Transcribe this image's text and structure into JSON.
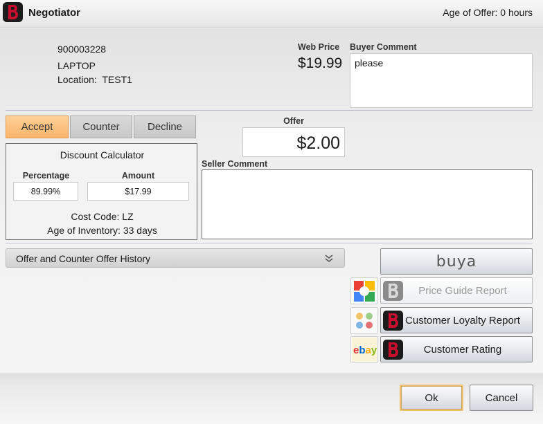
{
  "window": {
    "title": "Negotiator",
    "age_of_offer": "Age of Offer: 0 hours"
  },
  "item": {
    "number": "900003228",
    "name": "LAPTOP",
    "location": "Location:  TEST1"
  },
  "web_price": {
    "label": "Web Price",
    "value": "$19.99"
  },
  "buyer_comment": {
    "label": "Buyer Comment",
    "value": "please"
  },
  "tabs": {
    "accept": "Accept",
    "counter": "Counter",
    "decline": "Decline"
  },
  "calculator": {
    "title": "Discount Calculator",
    "percentage_label": "Percentage",
    "percentage_value": "89.99%",
    "amount_label": "Amount",
    "amount_value": "$17.99",
    "cost_code": "Cost Code: LZ",
    "age_of_inventory": "Age of Inventory: 33 days"
  },
  "offer": {
    "label": "Offer",
    "value": "$2.00"
  },
  "seller_comment": {
    "label": "Seller Comment",
    "value": ""
  },
  "history": {
    "label": "Offer and Counter Offer History"
  },
  "side_buttons": {
    "buya_label": "buya",
    "price_guide": "Price Guide Report",
    "customer_loyalty": "Customer Loyalty Report",
    "customer_rating": "Customer Rating"
  },
  "footer": {
    "ok": "Ok",
    "cancel": "Cancel"
  },
  "colors": {
    "accept_tab": "#f9b46a",
    "ok_border": "#f0c070",
    "logo_red": "#c8102e"
  }
}
